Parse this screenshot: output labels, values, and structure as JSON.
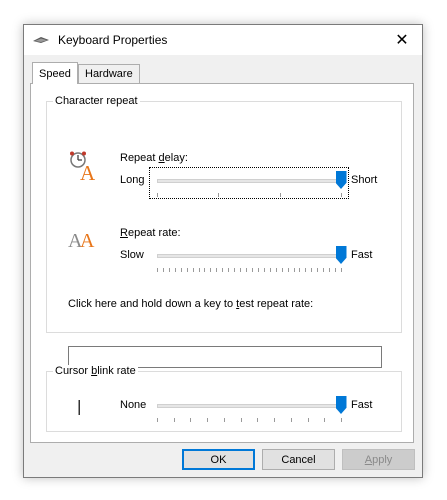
{
  "window": {
    "title": "Keyboard Properties"
  },
  "tabs": [
    {
      "label": "Speed",
      "active": true
    },
    {
      "label": "Hardware",
      "active": false
    }
  ],
  "character_repeat": {
    "title": "Character repeat",
    "repeat_delay": {
      "label_pre": "Repeat ",
      "label_key": "d",
      "label_post": "elay:",
      "min_label": "Long",
      "max_label": "Short",
      "value_fraction": 1.0,
      "tick_count": 4
    },
    "repeat_rate": {
      "label_key": "R",
      "label_post": "epeat rate:",
      "min_label": "Slow",
      "max_label": "Fast",
      "value_fraction": 1.0,
      "tick_count": 32
    },
    "test_label_pre": "Click here and hold down a key to ",
    "test_label_key": "t",
    "test_label_post": "est repeat rate:",
    "test_value": ""
  },
  "cursor_blink": {
    "title_pre": "Cursor ",
    "title_key": "b",
    "title_post": "link rate",
    "min_label": "None",
    "max_label": "Fast",
    "value_fraction": 1.0,
    "tick_count": 12
  },
  "buttons": {
    "ok": "OK",
    "cancel": "Cancel",
    "apply_key": "A",
    "apply_post": "pply"
  },
  "colors": {
    "accent": "#0078d7",
    "icon_orange": "#e8761a",
    "icon_gray": "#8a8a8a"
  }
}
